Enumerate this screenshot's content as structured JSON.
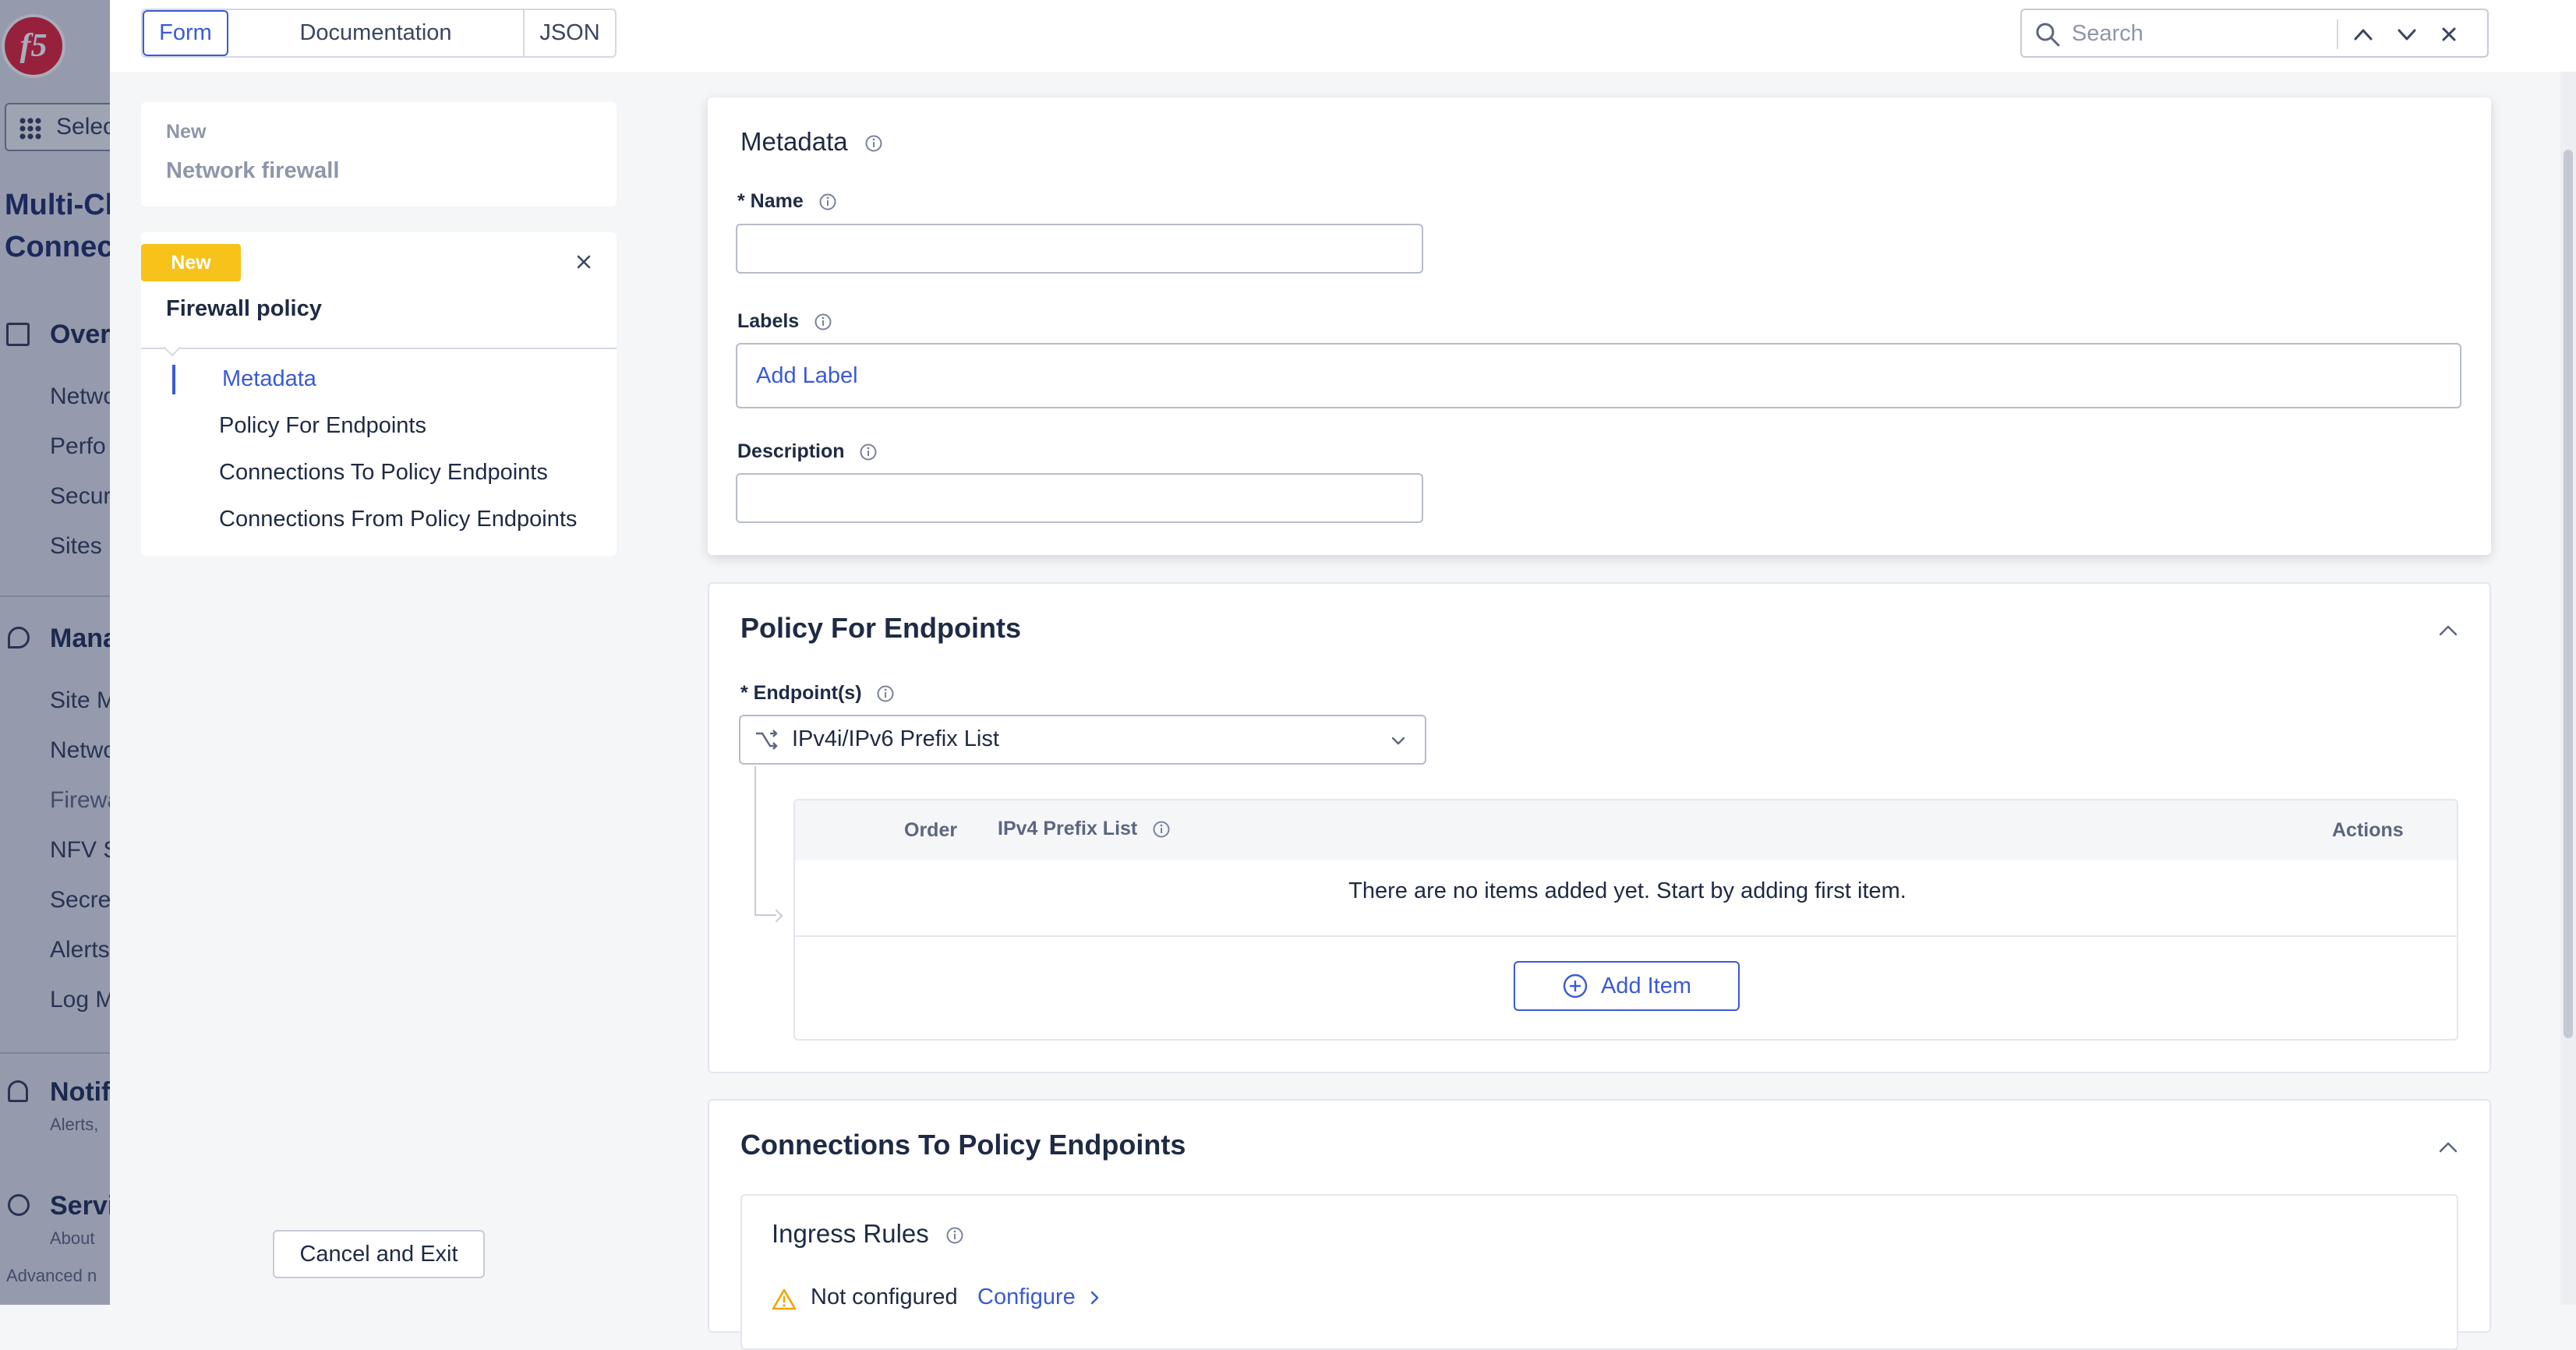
{
  "background_app": {
    "select_button": "Select",
    "title_line1": "Multi-Cl",
    "title_line2": "Connec",
    "sections": [
      {
        "label": "Over",
        "items": [
          "Netwo",
          "Perfo",
          "Secur",
          "Sites"
        ]
      },
      {
        "label": "Mana",
        "items": [
          "Site M",
          "Netwo",
          "Firewa",
          "NFV S",
          "Secre",
          "Alerts",
          "Log M"
        ]
      },
      {
        "label": "Notif",
        "sub": "Alerts,"
      },
      {
        "label": "Servi",
        "sub": "About"
      }
    ],
    "footer": "Advanced n"
  },
  "tabs": {
    "form": "Form",
    "documentation": "Documentation",
    "json": "JSON"
  },
  "search": {
    "placeholder": "Search",
    "value": ""
  },
  "sidebar": {
    "breadcrumb": {
      "badge": "New",
      "title": "Network firewall"
    },
    "current": {
      "badge": "New",
      "title": "Firewall policy"
    },
    "nav": [
      {
        "label": "Metadata",
        "active": true
      },
      {
        "label": "Policy For Endpoints",
        "active": false
      },
      {
        "label": "Connections To Policy Endpoints",
        "active": false
      },
      {
        "label": "Connections From Policy Endpoints",
        "active": false
      }
    ],
    "cancel_button": "Cancel and Exit"
  },
  "metadata": {
    "title": "Metadata",
    "name_label": "* Name",
    "name_value": "",
    "labels_label": "Labels",
    "labels_placeholder": "Add Label",
    "description_label": "Description",
    "description_value": ""
  },
  "policy_for_endpoints": {
    "title": "Policy For Endpoints",
    "endpoints_label": "* Endpoint(s)",
    "endpoints_selected": "IPv4i/IPv6 Prefix List",
    "table": {
      "columns": [
        "Order",
        "IPv4 Prefix List",
        "Actions"
      ],
      "empty_text": "There are no items added yet. Start by adding first item.",
      "add_button": "Add Item"
    }
  },
  "connections_to_policy_endpoints": {
    "title": "Connections To Policy Endpoints",
    "ingress_title": "Ingress Rules",
    "status": "Not configured",
    "configure_link": "Configure"
  },
  "colors": {
    "accent": "#3a5ad6",
    "badge": "#f7c21a",
    "warning": "#f0a500",
    "brand": "#e21d38"
  }
}
